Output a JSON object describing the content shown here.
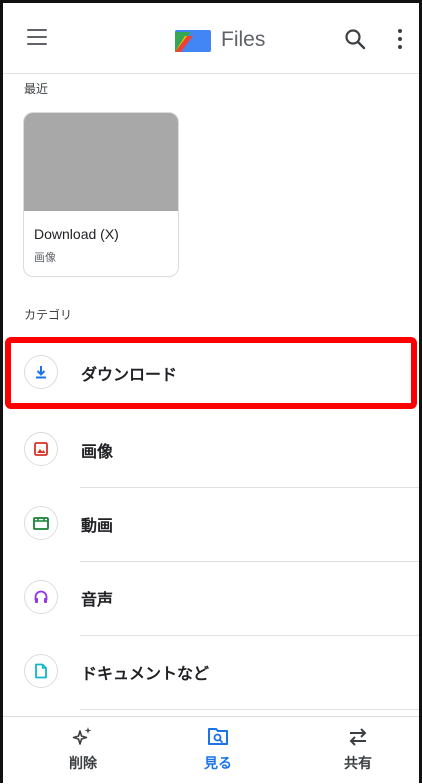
{
  "app": {
    "title": "Files"
  },
  "recent": {
    "label": "最近",
    "card": {
      "name": "Download (X)",
      "type": "画像"
    }
  },
  "categories": {
    "label": "カテゴリ",
    "items": [
      {
        "label": "ダウンロード",
        "icon": "download-icon",
        "color": "#1a73e8"
      },
      {
        "label": "画像",
        "icon": "image-icon",
        "color": "#d93025"
      },
      {
        "label": "動画",
        "icon": "video-icon",
        "color": "#188038"
      },
      {
        "label": "音声",
        "icon": "headphones-icon",
        "color": "#9334e6"
      },
      {
        "label": "ドキュメントなど",
        "icon": "document-icon",
        "color": "#12b5cb"
      }
    ]
  },
  "bottom_nav": {
    "items": [
      {
        "label": "削除",
        "icon": "sparkle-clean-icon"
      },
      {
        "label": "見る",
        "icon": "browse-icon",
        "active": true
      },
      {
        "label": "共有",
        "icon": "share-arrows-icon"
      }
    ]
  },
  "colors": {
    "accent": "#1a73e8",
    "highlight": "#ff0000"
  }
}
